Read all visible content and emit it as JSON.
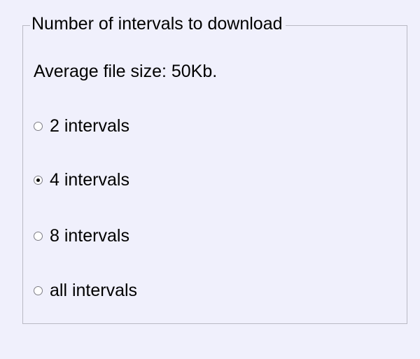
{
  "group": {
    "title": "Number of intervals to download",
    "info": "Average file size: 50Kb."
  },
  "options": [
    {
      "label": "2 intervals",
      "checked": false
    },
    {
      "label": "4 intervals",
      "checked": true
    },
    {
      "label": "8 intervals",
      "checked": false
    },
    {
      "label": "all intervals",
      "checked": false
    }
  ]
}
